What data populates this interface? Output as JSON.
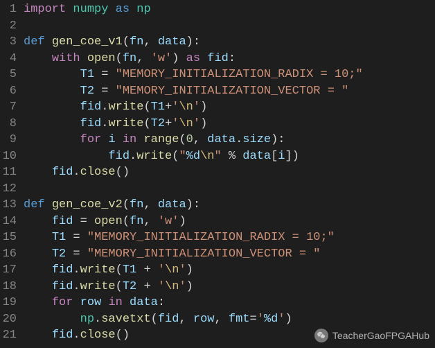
{
  "watermark": "TeacherGaoFPGAHub",
  "lines": [
    {
      "num": "1",
      "tokens": [
        {
          "t": "import",
          "c": "kw-import"
        },
        {
          "t": " ",
          "c": ""
        },
        {
          "t": "numpy",
          "c": "module"
        },
        {
          "t": " ",
          "c": ""
        },
        {
          "t": "as",
          "c": "kw-as"
        },
        {
          "t": " ",
          "c": ""
        },
        {
          "t": "np",
          "c": "module"
        }
      ]
    },
    {
      "num": "2",
      "tokens": []
    },
    {
      "num": "3",
      "tokens": [
        {
          "t": "def",
          "c": "kw-def"
        },
        {
          "t": " ",
          "c": ""
        },
        {
          "t": "gen_coe_v1",
          "c": "func-name"
        },
        {
          "t": "(",
          "c": "punct"
        },
        {
          "t": "fn",
          "c": "param"
        },
        {
          "t": ", ",
          "c": "punct"
        },
        {
          "t": "data",
          "c": "param"
        },
        {
          "t": "):",
          "c": "punct"
        }
      ]
    },
    {
      "num": "4",
      "tokens": [
        {
          "t": "    ",
          "c": ""
        },
        {
          "t": "with",
          "c": "kw-ctrl"
        },
        {
          "t": " ",
          "c": ""
        },
        {
          "t": "open",
          "c": "func-call"
        },
        {
          "t": "(",
          "c": "punct"
        },
        {
          "t": "fn",
          "c": "var"
        },
        {
          "t": ", ",
          "c": "punct"
        },
        {
          "t": "'w'",
          "c": "string"
        },
        {
          "t": ") ",
          "c": "punct"
        },
        {
          "t": "as",
          "c": "kw-ctrl"
        },
        {
          "t": " ",
          "c": ""
        },
        {
          "t": "fid",
          "c": "var"
        },
        {
          "t": ":",
          "c": "punct"
        }
      ]
    },
    {
      "num": "5",
      "tokens": [
        {
          "t": "        ",
          "c": ""
        },
        {
          "t": "T1",
          "c": "var"
        },
        {
          "t": " = ",
          "c": "punct"
        },
        {
          "t": "\"MEMORY_INITIALIZATION_RADIX = 10;\"",
          "c": "string"
        }
      ]
    },
    {
      "num": "6",
      "tokens": [
        {
          "t": "        ",
          "c": ""
        },
        {
          "t": "T2",
          "c": "var"
        },
        {
          "t": " = ",
          "c": "punct"
        },
        {
          "t": "\"MEMORY_INITIALIZATION_VECTOR = \"",
          "c": "string"
        }
      ]
    },
    {
      "num": "7",
      "tokens": [
        {
          "t": "        ",
          "c": ""
        },
        {
          "t": "fid",
          "c": "var"
        },
        {
          "t": ".",
          "c": "punct"
        },
        {
          "t": "write",
          "c": "func-call"
        },
        {
          "t": "(",
          "c": "punct"
        },
        {
          "t": "T1",
          "c": "var"
        },
        {
          "t": "+",
          "c": "punct"
        },
        {
          "t": "'",
          "c": "string"
        },
        {
          "t": "\\n",
          "c": "escape"
        },
        {
          "t": "'",
          "c": "string"
        },
        {
          "t": ")",
          "c": "punct"
        }
      ]
    },
    {
      "num": "8",
      "tokens": [
        {
          "t": "        ",
          "c": ""
        },
        {
          "t": "fid",
          "c": "var"
        },
        {
          "t": ".",
          "c": "punct"
        },
        {
          "t": "write",
          "c": "func-call"
        },
        {
          "t": "(",
          "c": "punct"
        },
        {
          "t": "T2",
          "c": "var"
        },
        {
          "t": "+",
          "c": "punct"
        },
        {
          "t": "'",
          "c": "string"
        },
        {
          "t": "\\n",
          "c": "escape"
        },
        {
          "t": "'",
          "c": "string"
        },
        {
          "t": ")",
          "c": "punct"
        }
      ]
    },
    {
      "num": "9",
      "tokens": [
        {
          "t": "        ",
          "c": ""
        },
        {
          "t": "for",
          "c": "kw-ctrl"
        },
        {
          "t": " ",
          "c": ""
        },
        {
          "t": "i",
          "c": "var"
        },
        {
          "t": " ",
          "c": ""
        },
        {
          "t": "in",
          "c": "kw-ctrl"
        },
        {
          "t": " ",
          "c": ""
        },
        {
          "t": "range",
          "c": "func-call"
        },
        {
          "t": "(",
          "c": "punct"
        },
        {
          "t": "0",
          "c": "number"
        },
        {
          "t": ", ",
          "c": "punct"
        },
        {
          "t": "data",
          "c": "var"
        },
        {
          "t": ".",
          "c": "punct"
        },
        {
          "t": "size",
          "c": "var"
        },
        {
          "t": "):",
          "c": "punct"
        }
      ]
    },
    {
      "num": "10",
      "tokens": [
        {
          "t": "            ",
          "c": ""
        },
        {
          "t": "fid",
          "c": "var"
        },
        {
          "t": ".",
          "c": "punct"
        },
        {
          "t": "write",
          "c": "func-call"
        },
        {
          "t": "(",
          "c": "punct"
        },
        {
          "t": "\"",
          "c": "string"
        },
        {
          "t": "%d",
          "c": "var"
        },
        {
          "t": "\\n",
          "c": "escape"
        },
        {
          "t": "\"",
          "c": "string"
        },
        {
          "t": " % ",
          "c": "punct"
        },
        {
          "t": "data",
          "c": "var"
        },
        {
          "t": "[",
          "c": "punct"
        },
        {
          "t": "i",
          "c": "var"
        },
        {
          "t": "])",
          "c": "punct"
        }
      ]
    },
    {
      "num": "11",
      "tokens": [
        {
          "t": "    ",
          "c": ""
        },
        {
          "t": "fid",
          "c": "var"
        },
        {
          "t": ".",
          "c": "punct"
        },
        {
          "t": "close",
          "c": "func-call"
        },
        {
          "t": "()",
          "c": "punct"
        }
      ]
    },
    {
      "num": "12",
      "tokens": []
    },
    {
      "num": "13",
      "tokens": [
        {
          "t": "def",
          "c": "kw-def"
        },
        {
          "t": " ",
          "c": ""
        },
        {
          "t": "gen_coe_v2",
          "c": "func-name"
        },
        {
          "t": "(",
          "c": "punct"
        },
        {
          "t": "fn",
          "c": "param"
        },
        {
          "t": ", ",
          "c": "punct"
        },
        {
          "t": "data",
          "c": "param"
        },
        {
          "t": "):",
          "c": "punct"
        }
      ]
    },
    {
      "num": "14",
      "tokens": [
        {
          "t": "    ",
          "c": ""
        },
        {
          "t": "fid",
          "c": "var"
        },
        {
          "t": " = ",
          "c": "punct"
        },
        {
          "t": "open",
          "c": "func-call"
        },
        {
          "t": "(",
          "c": "punct"
        },
        {
          "t": "fn",
          "c": "var"
        },
        {
          "t": ", ",
          "c": "punct"
        },
        {
          "t": "'w'",
          "c": "string"
        },
        {
          "t": ")",
          "c": "punct"
        }
      ]
    },
    {
      "num": "15",
      "tokens": [
        {
          "t": "    ",
          "c": ""
        },
        {
          "t": "T1",
          "c": "var"
        },
        {
          "t": " = ",
          "c": "punct"
        },
        {
          "t": "\"MEMORY_INITIALIZATION_RADIX = 10;\"",
          "c": "string"
        }
      ]
    },
    {
      "num": "16",
      "tokens": [
        {
          "t": "    ",
          "c": ""
        },
        {
          "t": "T2",
          "c": "var"
        },
        {
          "t": " = ",
          "c": "punct"
        },
        {
          "t": "\"MEMORY_INITIALIZATION_VECTOR = \"",
          "c": "string"
        }
      ]
    },
    {
      "num": "17",
      "tokens": [
        {
          "t": "    ",
          "c": ""
        },
        {
          "t": "fid",
          "c": "var"
        },
        {
          "t": ".",
          "c": "punct"
        },
        {
          "t": "write",
          "c": "func-call"
        },
        {
          "t": "(",
          "c": "punct"
        },
        {
          "t": "T1",
          "c": "var"
        },
        {
          "t": " + ",
          "c": "punct"
        },
        {
          "t": "'",
          "c": "string"
        },
        {
          "t": "\\n",
          "c": "escape"
        },
        {
          "t": "'",
          "c": "string"
        },
        {
          "t": ")",
          "c": "punct"
        }
      ]
    },
    {
      "num": "18",
      "tokens": [
        {
          "t": "    ",
          "c": ""
        },
        {
          "t": "fid",
          "c": "var"
        },
        {
          "t": ".",
          "c": "punct"
        },
        {
          "t": "write",
          "c": "func-call"
        },
        {
          "t": "(",
          "c": "punct"
        },
        {
          "t": "T2",
          "c": "var"
        },
        {
          "t": " + ",
          "c": "punct"
        },
        {
          "t": "'",
          "c": "string"
        },
        {
          "t": "\\n",
          "c": "escape"
        },
        {
          "t": "'",
          "c": "string"
        },
        {
          "t": ")",
          "c": "punct"
        }
      ]
    },
    {
      "num": "19",
      "tokens": [
        {
          "t": "    ",
          "c": ""
        },
        {
          "t": "for",
          "c": "kw-ctrl"
        },
        {
          "t": " ",
          "c": ""
        },
        {
          "t": "row",
          "c": "var"
        },
        {
          "t": " ",
          "c": ""
        },
        {
          "t": "in",
          "c": "kw-ctrl"
        },
        {
          "t": " ",
          "c": ""
        },
        {
          "t": "data",
          "c": "var"
        },
        {
          "t": ":",
          "c": "punct"
        }
      ]
    },
    {
      "num": "20",
      "tokens": [
        {
          "t": "        ",
          "c": ""
        },
        {
          "t": "np",
          "c": "module"
        },
        {
          "t": ".",
          "c": "punct"
        },
        {
          "t": "savetxt",
          "c": "func-call"
        },
        {
          "t": "(",
          "c": "punct"
        },
        {
          "t": "fid",
          "c": "var"
        },
        {
          "t": ", ",
          "c": "punct"
        },
        {
          "t": "row",
          "c": "var"
        },
        {
          "t": ", ",
          "c": "punct"
        },
        {
          "t": "fmt",
          "c": "param"
        },
        {
          "t": "=",
          "c": "punct"
        },
        {
          "t": "'",
          "c": "string"
        },
        {
          "t": "%d",
          "c": "var"
        },
        {
          "t": "'",
          "c": "string"
        },
        {
          "t": ")",
          "c": "punct"
        }
      ]
    },
    {
      "num": "21",
      "tokens": [
        {
          "t": "    ",
          "c": ""
        },
        {
          "t": "fid",
          "c": "var"
        },
        {
          "t": ".",
          "c": "punct"
        },
        {
          "t": "close",
          "c": "func-call"
        },
        {
          "t": "()",
          "c": "punct"
        }
      ]
    }
  ]
}
